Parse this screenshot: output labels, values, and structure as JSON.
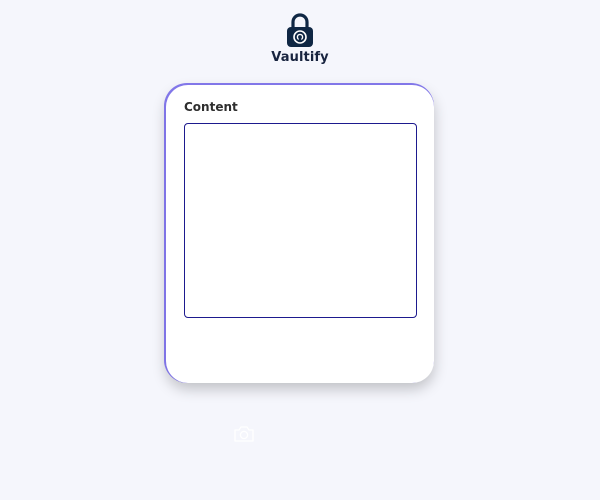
{
  "brand": {
    "name": "Vaultify",
    "icon": "lock-icon",
    "icon_color": "#0f2744"
  },
  "form": {
    "content_label": "Content",
    "content_value": "",
    "border_color": "#1d1a8e",
    "accent_color": "#6e62e6"
  },
  "footer": {
    "camera_icon": "camera-icon"
  }
}
